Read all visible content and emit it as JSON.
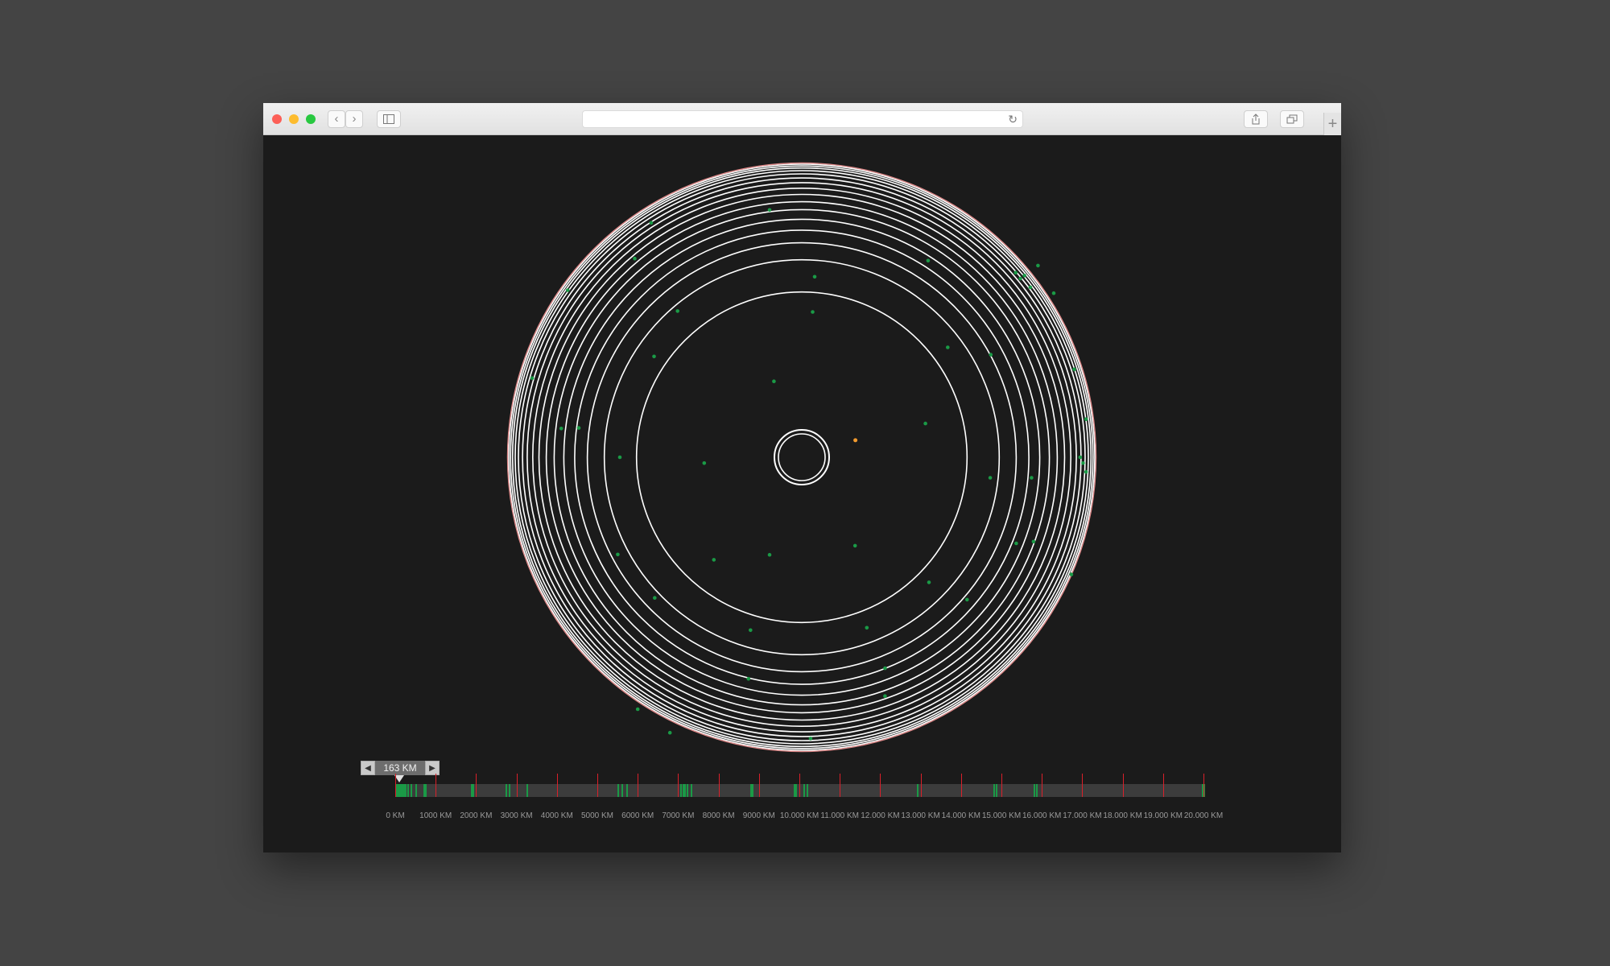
{
  "browser": {
    "traffic_lights": [
      "close",
      "minimize",
      "zoom"
    ],
    "address": "",
    "icons": [
      "back-icon",
      "forward-icon",
      "sidebar-icon",
      "reload-icon",
      "share-icon",
      "tabs-icon",
      "new-tab-icon"
    ]
  },
  "colors": {
    "background": "#444444",
    "canvas": "#1b1b1b",
    "ring": "#ffffff",
    "outer_ring": "#e08a8a",
    "dot": "#1a9a46",
    "highlight_dot": "#f29a2e",
    "tick": "#d9202a",
    "track": "#3c3c3c"
  },
  "control": {
    "prev_icon": "◀",
    "value": "163 KM",
    "next_icon": "▶"
  },
  "timeline": {
    "max_km": 20000,
    "current_km": 163,
    "tick_labels": [
      "0 KM",
      "1000 KM",
      "2000 KM",
      "3000 KM",
      "4000 KM",
      "5000 KM",
      "6000 KM",
      "7000 KM",
      "8000 KM",
      "9000 KM",
      "10.000 KM",
      "11.000 KM",
      "12.000 KM",
      "13.000 KM",
      "14.000 KM",
      "15.000 KM",
      "16.000 KM",
      "17.000 KM",
      "18.000 KM",
      "19.000 KM",
      "20.000 KM"
    ],
    "event_marks_km": [
      20,
      60,
      90,
      120,
      160,
      190,
      230,
      300,
      380,
      500,
      700,
      740,
      1880,
      1920,
      2720,
      2800,
      3250,
      5500,
      5600,
      5720,
      7060,
      7120,
      7160,
      7220,
      7300,
      8780,
      8830,
      9850,
      9900,
      10100,
      10170,
      12900,
      14800,
      14850,
      15800,
      15850,
      19950,
      20000
    ]
  },
  "disc": {
    "ring_radii_fraction": [
      0.564,
      0.674,
      0.732,
      0.775,
      0.812,
      0.845,
      0.872,
      0.897,
      0.918,
      0.937,
      0.953,
      0.967,
      0.978,
      0.987,
      0.994,
      1.0
    ],
    "dots": [
      [
        -0.11,
        -0.844
      ],
      [
        0.044,
        -0.616
      ],
      [
        0.037,
        -0.496
      ],
      [
        -0.424,
        -0.499
      ],
      [
        -0.504,
        -0.344
      ],
      [
        -0.095,
        -0.259
      ],
      [
        0.431,
        -0.671
      ],
      [
        0.498,
        -0.375
      ],
      [
        0.645,
        -0.35
      ],
      [
        0.86,
        -0.56
      ],
      [
        0.806,
        -0.654
      ],
      [
        0.422,
        -0.115
      ],
      [
        0.643,
        0.07
      ],
      [
        0.784,
        0.07
      ],
      [
        -0.333,
        0.02
      ],
      [
        -0.621,
        0.0
      ],
      [
        -0.761,
        -0.1
      ],
      [
        -0.821,
        -0.098
      ],
      [
        -0.628,
        0.332
      ],
      [
        -0.502,
        0.48
      ],
      [
        -0.3,
        0.35
      ],
      [
        -0.11,
        0.333
      ],
      [
        0.182,
        0.302
      ],
      [
        -0.175,
        0.59
      ],
      [
        0.222,
        0.582
      ],
      [
        -0.182,
        0.756
      ],
      [
        0.284,
        0.72
      ],
      [
        0.284,
        0.815
      ],
      [
        0.434,
        0.427
      ],
      [
        0.564,
        0.486
      ],
      [
        0.732,
        0.294
      ],
      [
        0.791,
        0.288
      ],
      [
        -0.514,
        -0.8
      ],
      [
        -0.57,
        -0.678
      ],
      [
        -0.799,
        -0.57
      ],
      [
        -0.92,
        -0.27
      ],
      [
        0.746,
        -0.61
      ],
      [
        0.93,
        -0.3
      ],
      [
        0.97,
        -0.13
      ],
      [
        0.97,
        0.05
      ],
      [
        -0.56,
        0.86
      ],
      [
        -0.45,
        0.94
      ],
      [
        0.03,
        0.96
      ],
      [
        0.92,
        0.4
      ],
      [
        0.73,
        -0.63
      ],
      [
        0.76,
        -0.62
      ],
      [
        0.78,
        -0.58
      ],
      [
        0.95,
        -0.0
      ],
      [
        0.96,
        0.02
      ]
    ],
    "highlight_dot": [
      0.183,
      -0.058
    ]
  }
}
